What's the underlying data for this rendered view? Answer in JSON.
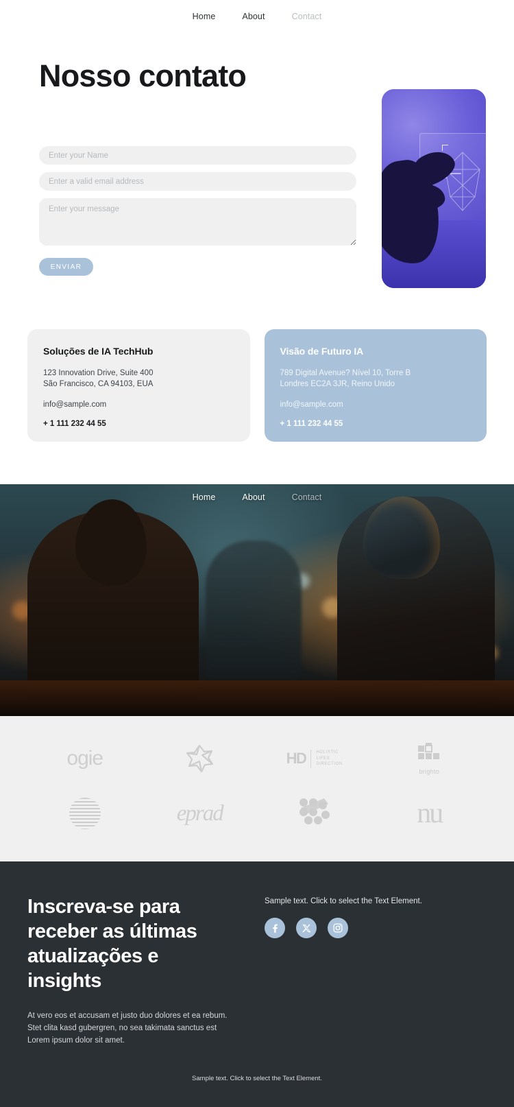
{
  "nav": {
    "items": [
      {
        "label": "Home",
        "muted": false
      },
      {
        "label": "About",
        "muted": false
      },
      {
        "label": "Contact",
        "muted": true
      }
    ]
  },
  "contact": {
    "title": "Nosso contato",
    "form": {
      "name_placeholder": "Enter your Name",
      "email_placeholder": "Enter a valid email address",
      "message_placeholder": "Enter your message",
      "submit_label": "ENVIAR"
    },
    "hero_image_alt": "hand-touching-holographic-screen"
  },
  "cards": [
    {
      "title": "Soluções de IA TechHub",
      "line1": "123 Innovation Drive, Suite 400",
      "line2": "São Francisco, CA 94103, EUA",
      "email": "info@sample.com",
      "phone": "+ 1 111 232 44 55",
      "style": "grey"
    },
    {
      "title": "Visão de Futuro IA",
      "line1": "789 Digital Avenue? Nível 10, Torre B",
      "line2": "Londres EC2A 3JR, Reino Unido",
      "email": "info@sample.com",
      "phone": "+ 1 111 232 44 55",
      "style": "blue"
    }
  ],
  "photo_band": {
    "alt": "woman-working-beside-humanoid-robot"
  },
  "logos": [
    {
      "name": "ogie",
      "kind": "word"
    },
    {
      "name": "flower",
      "kind": "mark"
    },
    {
      "name": "HD",
      "sub1": "HOLISTIC",
      "sub2": "LIFES",
      "sub3": "DIRECTION",
      "kind": "hd"
    },
    {
      "name": "brighto",
      "kind": "brighto"
    },
    {
      "name": "stripe-circle",
      "kind": "stripes"
    },
    {
      "name": "eprad",
      "kind": "script"
    },
    {
      "name": "dots",
      "kind": "dots"
    },
    {
      "name": "nu",
      "kind": "nu"
    }
  ],
  "footer": {
    "title": "Inscreva-se para receber as últimas atualizações e insights",
    "paragraph": "At vero eos et accusam et justo duo dolores et ea rebum. Stet clita kasd gubergren, no sea takimata sanctus est Lorem ipsum dolor sit amet.",
    "sample_text": "Sample text. Click to select the Text Element.",
    "socials": [
      {
        "name": "facebook"
      },
      {
        "name": "x-twitter"
      },
      {
        "name": "instagram"
      }
    ],
    "bottom_text": "Sample text. Click to select the Text Element."
  },
  "colors": {
    "accent_blue": "#a9c2da",
    "panel_grey": "#f0f0f0",
    "footer_dark": "#2b3034"
  }
}
